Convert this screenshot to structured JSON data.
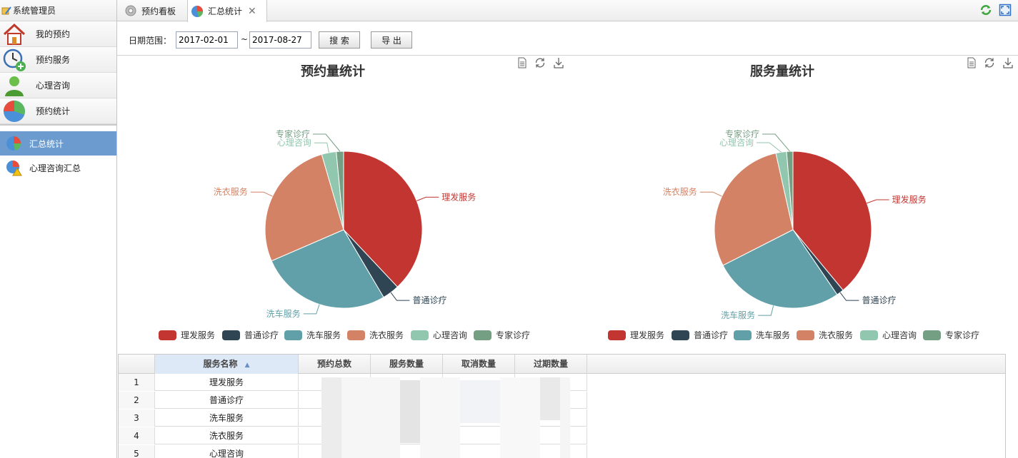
{
  "sidebar": {
    "header": "系统管理员",
    "menu_main": [
      {
        "label": "我的预约",
        "icon": "house-icon"
      },
      {
        "label": "预约服务",
        "icon": "clock-add-icon"
      },
      {
        "label": "心理咨询",
        "icon": "person-icon"
      },
      {
        "label": "预约统计",
        "icon": "pie-chart-icon"
      }
    ],
    "menu_sub": [
      {
        "label": "汇总统计",
        "icon": "pie-chart-small-icon",
        "active": true
      },
      {
        "label": "心理咨询汇总",
        "icon": "pie-chart-warning-icon",
        "active": false
      }
    ]
  },
  "tabs": [
    {
      "label": "预约看板",
      "icon": "gear-icon"
    },
    {
      "label": "汇总统计",
      "icon": "pie-chart-icon",
      "close": "✕",
      "active": true
    }
  ],
  "toolbar": {
    "date_label": "日期范围：",
    "date_from": "2017-02-01",
    "separator": "~",
    "date_to": "2017-08-27",
    "search_label": "搜 索",
    "export_label": "导 出"
  },
  "colors": {
    "理发服务": "#c23531",
    "普通诊疗": "#2f4554",
    "洗车服务": "#61a0a8",
    "洗衣服务": "#d48265",
    "心理咨询": "#91c7ae",
    "专家诊疗": "#749f83",
    "active_menu": "#6c9ccf"
  },
  "chart_data": [
    {
      "type": "pie",
      "title": "预约量统计",
      "legend_position": "bottom",
      "categories": [
        "理发服务",
        "普通诊疗",
        "洗车服务",
        "洗衣服务",
        "心理咨询",
        "专家诊疗"
      ],
      "values": [
        38,
        3.5,
        27,
        27,
        3,
        1.5
      ]
    },
    {
      "type": "pie",
      "title": "服务量统计",
      "legend_position": "bottom",
      "categories": [
        "理发服务",
        "普通诊疗",
        "洗车服务",
        "洗衣服务",
        "心理咨询",
        "专家诊疗"
      ],
      "values": [
        39,
        1.5,
        27,
        29,
        2.2,
        1.3
      ]
    }
  ],
  "table": {
    "columns": [
      "服务名称",
      "预约总数",
      "服务数量",
      "取消数量",
      "过期数量"
    ],
    "sort_indicator": "▲",
    "rows": [
      {
        "index": "1",
        "name": "理发服务"
      },
      {
        "index": "2",
        "name": "普通诊疗"
      },
      {
        "index": "3",
        "name": "洗车服务"
      },
      {
        "index": "4",
        "name": "洗衣服务"
      },
      {
        "index": "5",
        "name": "心理咨询"
      }
    ]
  }
}
